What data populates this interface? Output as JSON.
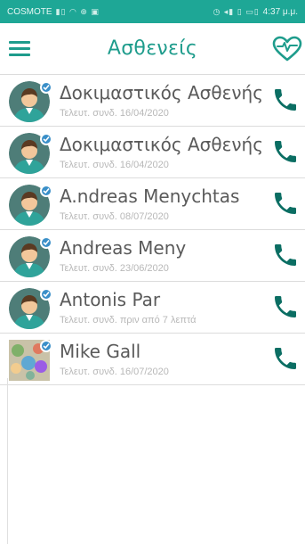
{
  "status_bar": {
    "carrier": "COSMOTE",
    "left_glyphs": "▮▯ ◠ ⊕ ▣",
    "right_glyphs": "◷ ◂▮ ▯ ▭▯",
    "battery_time": "4:37 μ.μ."
  },
  "header": {
    "title": "Ασθενείς",
    "menu_icon": "hamburger-menu-icon",
    "heart_icon": "heart-rate-icon"
  },
  "colors": {
    "status_bar": "#1ea796",
    "accent": "#1e9c8c",
    "call_icon": "#0b6e63",
    "badge": "#3a8fc8",
    "divider": "#dcdcdc"
  },
  "patients": [
    {
      "name": "Δοκιμαστικός Ασθενής",
      "last_login": "Τελευτ. συνδ. 16/04/2020",
      "avatar": "default"
    },
    {
      "name": "Δοκιμαστικός Ασθενής",
      "last_login": "Τελευτ. συνδ. 16/04/2020",
      "avatar": "default"
    },
    {
      "name": "A.ndreas Menychtas",
      "last_login": "Τελευτ. συνδ. 08/07/2020",
      "avatar": "default"
    },
    {
      "name": "Andreas Meny",
      "last_login": "Τελευτ. συνδ. 23/06/2020",
      "avatar": "default"
    },
    {
      "name": "Antonis Par",
      "last_login": "Τελευτ. συνδ. πριν από 7 λεπτά",
      "avatar": "default"
    },
    {
      "name": "Mike Gall",
      "last_login": "Τελευτ. συνδ. 16/07/2020",
      "avatar": "photo"
    }
  ]
}
